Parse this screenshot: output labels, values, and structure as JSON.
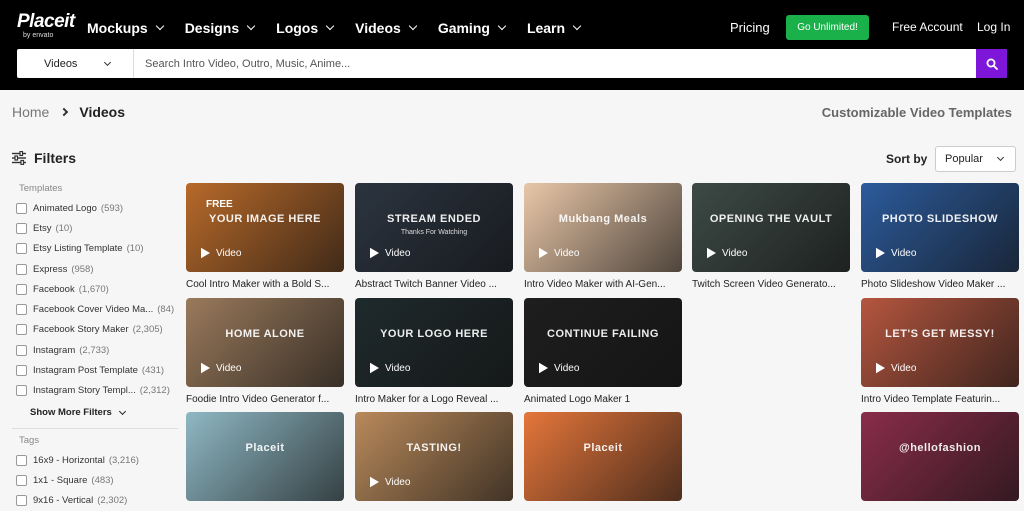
{
  "header": {
    "logo_main": "Placeit",
    "logo_sub": "by envato",
    "nav": [
      {
        "label": "Mockups"
      },
      {
        "label": "Designs"
      },
      {
        "label": "Logos"
      },
      {
        "label": "Videos"
      },
      {
        "label": "Gaming"
      },
      {
        "label": "Learn"
      }
    ],
    "pricing": "Pricing",
    "go_unlimited": "Go Unlimited!",
    "free_account": "Free Account",
    "login": "Log In"
  },
  "search": {
    "category": "Videos",
    "placeholder": "Search Intro Video, Outro, Music, Anime..."
  },
  "breadcrumb": {
    "home": "Home",
    "current": "Videos"
  },
  "page_heading": "Customizable Video Templates",
  "filters": {
    "title": "Filters",
    "templates_title": "Templates",
    "templates": [
      {
        "label": "Animated Logo",
        "count": "(593)"
      },
      {
        "label": "Etsy",
        "count": "(10)"
      },
      {
        "label": "Etsy Listing Template",
        "count": "(10)"
      },
      {
        "label": "Express",
        "count": "(958)"
      },
      {
        "label": "Facebook",
        "count": "(1,670)"
      },
      {
        "label": "Facebook Cover Video Ma...",
        "count": "(84)"
      },
      {
        "label": "Facebook Story Maker",
        "count": "(2,305)"
      },
      {
        "label": "Instagram",
        "count": "(2,733)"
      },
      {
        "label": "Instagram Post Template",
        "count": "(431)"
      },
      {
        "label": "Instagram Story Templ...",
        "count": "(2,312)"
      }
    ],
    "show_more": "Show More Filters",
    "tags_title": "Tags",
    "tags": [
      {
        "label": "16x9 - Horizontal",
        "count": "(3,216)"
      },
      {
        "label": "1x1 - Square",
        "count": "(483)"
      },
      {
        "label": "9x16 - Vertical",
        "count": "(2,302)"
      }
    ]
  },
  "sort": {
    "label": "Sort by",
    "value": "Popular"
  },
  "cards": [
    {
      "title": "Cool Intro Maker with a Bold S...",
      "type": "Video",
      "badge": "FREE",
      "overlay": "YOUR IMAGE HERE",
      "bg": "#b86a2a"
    },
    {
      "title": "Abstract Twitch Banner Video ...",
      "type": "Video",
      "overlay": "STREAM ENDED",
      "overlay2": "Thanks For Watching",
      "bg": "#2b3440"
    },
    {
      "title": "Intro Video Maker with AI-Gen...",
      "type": "Video",
      "overlay": "Mukbang Meals",
      "bg": "#e9c7a8"
    },
    {
      "title": "Twitch Screen Video Generato...",
      "type": "Video",
      "overlay": "OPENING THE VAULT",
      "bg": "#3d4a46"
    },
    {
      "title": "Photo Slideshow Video Maker ...",
      "type": "Video",
      "overlay": "PHOTO SLIDESHOW",
      "bg": "#2c5b9c"
    },
    {
      "title": "Foodie Intro Video Generator f...",
      "type": "Video",
      "overlay": "HOME ALONE",
      "bg": "#9a7a5c"
    },
    {
      "title": "Intro Maker for a Logo Reveal ...",
      "type": "Video",
      "overlay": "YOUR LOGO HERE",
      "bg": "#1f2a2c"
    },
    {
      "title": "Animated Logo Maker 1",
      "type": "Video",
      "overlay": "CONTINUE FAILING",
      "bg": "#1e1e1e"
    },
    {
      "title": "Intro Video Template Featurin...",
      "type": "Video",
      "overlay": "LET'S GET MESSY!",
      "bg": "#b5563f"
    },
    {
      "title": "",
      "type": "",
      "overlay": "Placeit",
      "bg": "#8fb8c4"
    },
    {
      "title": "",
      "type": "Video",
      "overlay": "TASTING!",
      "bg": "#b98a5b"
    },
    {
      "title": "",
      "type": "",
      "overlay": "Placeit",
      "bg": "#e5763b"
    },
    {
      "title": "",
      "type": "",
      "overlay": "@hellofashion",
      "bg": "#8a2d4a"
    }
  ],
  "colors": {
    "accent": "#7d16d9",
    "cta": "#1bb14a",
    "header_bg": "#000000"
  }
}
